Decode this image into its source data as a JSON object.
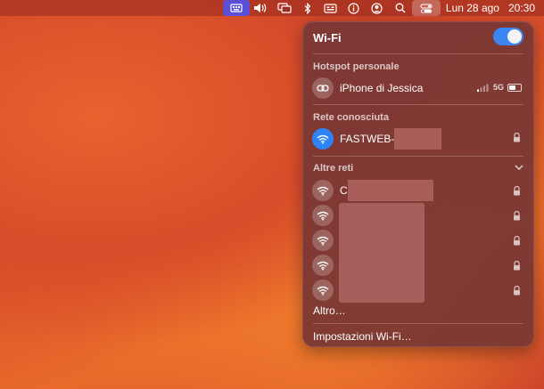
{
  "menubar": {
    "date": "Lun 28 ago",
    "time": "20:30",
    "icons": [
      "keyboard-icon",
      "volume-icon",
      "screen-mirroring-icon",
      "bluetooth-icon",
      "input-source-icon",
      "info-icon",
      "user-icon",
      "search-icon",
      "control-center-icon"
    ]
  },
  "wifi_menu": {
    "title": "Wi-Fi",
    "toggle_on": true,
    "sections": {
      "hotspot_label": "Hotspot personale",
      "known_label": "Rete conosciuta",
      "other_label": "Altre reti"
    },
    "hotspot": {
      "name": "iPhone di Jessica",
      "network_type": "5G",
      "battery_level": 0.6
    },
    "known_network": {
      "name": "FASTWEB-"
    },
    "other_networks": [
      {
        "name": "C"
      },
      {
        "name": ""
      },
      {
        "name": ""
      },
      {
        "name": ""
      },
      {
        "name": ""
      }
    ],
    "other_item": "Altro…",
    "settings_item": "Impostazioni Wi-Fi…"
  },
  "colors": {
    "accent_blue": "#2e84f4",
    "toggle_blue": "#3a86f2"
  }
}
